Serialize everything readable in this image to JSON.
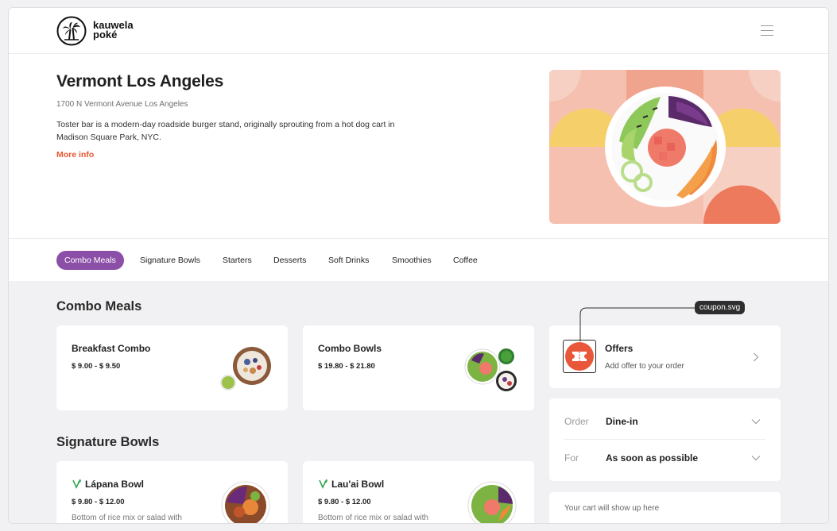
{
  "brand": {
    "line1": "kauwela",
    "line2": "poké"
  },
  "store": {
    "name": "Vermont Los Angeles",
    "address": "1700 N Vermont Avenue Los Angeles",
    "description": "Toster bar is a modern-day roadside burger stand, originally sprouting from a hot dog cart in Madison Square Park, NYC.",
    "more_info": "More info"
  },
  "tabs": [
    "Combo Meals",
    "Signature Bowls",
    "Starters",
    "Desserts",
    "Soft Drinks",
    "Smoothies",
    "Coffee"
  ],
  "sections": {
    "combo": {
      "title": "Combo Meals",
      "items": [
        {
          "name": "Breakfast Combo",
          "price": "$ 9.00 - $ 9.50"
        },
        {
          "name": "Combo Bowls",
          "price": "$ 19.80 - $ 21.80"
        }
      ]
    },
    "signature": {
      "title": "Signature Bowls",
      "items": [
        {
          "name": "Lápana Bowl",
          "price": "$ 9.80 - $ 12.00",
          "desc": "Bottom of rice mix or salad with"
        },
        {
          "name": "Lau'ai Bowl",
          "price": "$ 9.80 - $ 12.00",
          "desc": "Bottom of rice mix or salad with"
        }
      ]
    }
  },
  "offers": {
    "title": "Offers",
    "subtitle": "Add offer to your order",
    "annotation": "coupon.svg"
  },
  "order": {
    "order_label": "Order",
    "order_value": "Dine-in",
    "for_label": "For",
    "for_value": "As soon as possible"
  },
  "cart": {
    "message": "Your cart will show up here"
  },
  "colors": {
    "accent": "#8c4fa7",
    "link": "#e8552f",
    "coupon": "#e9573a",
    "vegan": "#3aa655"
  }
}
